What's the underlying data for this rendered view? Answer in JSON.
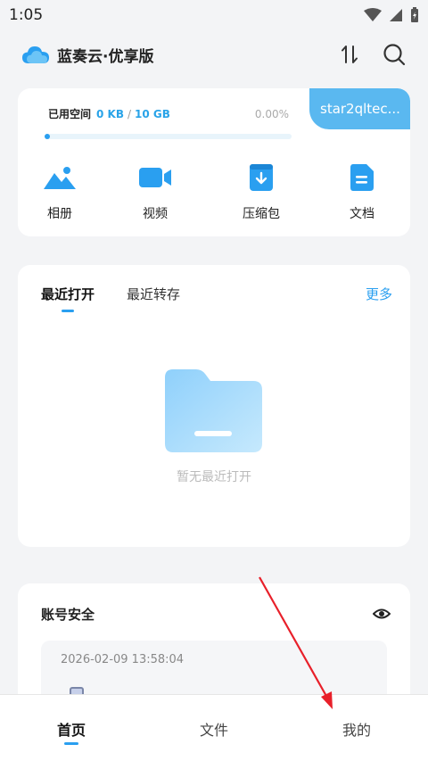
{
  "status_bar": {
    "time": "1:05"
  },
  "header": {
    "title": "蓝奏云·优享版",
    "logo_icon": "cloud-icon",
    "sort_icon": "transfer-icon",
    "search_icon": "search-icon"
  },
  "storage": {
    "label": "已用空间",
    "used": "0 KB",
    "separator": "/",
    "total": "10 GB",
    "percent_text": "0.00%",
    "progress_fraction": 0.0,
    "username": "star2qltec..."
  },
  "quick_actions": [
    {
      "label": "相册",
      "icon": "photo-icon"
    },
    {
      "label": "视频",
      "icon": "video-icon"
    },
    {
      "label": "压缩包",
      "icon": "archive-icon"
    },
    {
      "label": "文档",
      "icon": "document-icon"
    }
  ],
  "recent": {
    "tabs": [
      {
        "label": "最近打开"
      },
      {
        "label": "最近转存"
      }
    ],
    "more_label": "更多",
    "empty_text": "暂无最近打开"
  },
  "security": {
    "title": "账号安全",
    "login_time": "2026-02-09 13:58:04"
  },
  "bottom_nav": [
    {
      "label": "首页"
    },
    {
      "label": "文件"
    },
    {
      "label": "我的"
    }
  ],
  "colors": {
    "accent": "#2a9ff0",
    "tag_bg": "#5ab8f0",
    "annotation": "#e8202a"
  }
}
